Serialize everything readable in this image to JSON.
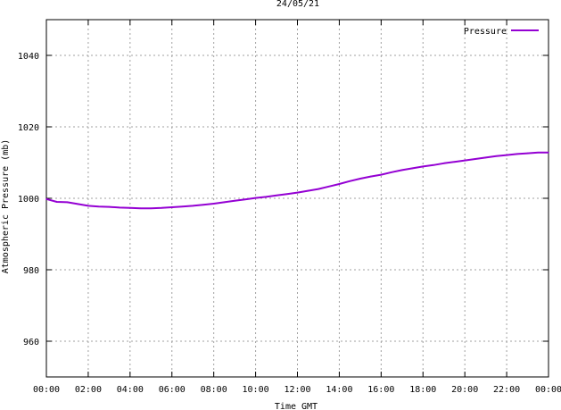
{
  "chart_data": {
    "type": "line",
    "title": "24/05/21",
    "xlabel": "Time GMT",
    "ylabel": "Atmospheric Pressure (mb)",
    "xlim": [
      0,
      24
    ],
    "ylim": [
      950,
      1050
    ],
    "x_ticks": [
      "00:00",
      "02:00",
      "04:00",
      "06:00",
      "08:00",
      "10:00",
      "12:00",
      "14:00",
      "16:00",
      "18:00",
      "20:00",
      "22:00",
      "00:00"
    ],
    "y_ticks": [
      960,
      980,
      1000,
      1020,
      1040
    ],
    "grid": true,
    "legend_position": "top-right",
    "series": [
      {
        "name": "Pressure",
        "color": "#9400d3",
        "x": [
          0,
          0.5,
          1,
          1.5,
          2,
          2.5,
          3,
          3.5,
          4,
          4.5,
          5,
          5.5,
          6,
          6.5,
          7,
          7.5,
          8,
          8.5,
          9,
          9.5,
          10,
          10.5,
          11,
          11.5,
          12,
          12.5,
          13,
          13.5,
          14,
          14.5,
          15,
          15.5,
          16,
          16.5,
          17,
          17.5,
          18,
          18.5,
          19,
          19.5,
          20,
          20.5,
          21,
          21.5,
          22,
          22.5,
          23,
          23.5,
          24
        ],
        "values": [
          999.8,
          999.0,
          998.9,
          998.4,
          997.9,
          997.7,
          997.6,
          997.4,
          997.3,
          997.2,
          997.2,
          997.3,
          997.5,
          997.7,
          997.9,
          998.2,
          998.5,
          998.9,
          999.3,
          999.7,
          1000.1,
          1000.4,
          1000.8,
          1001.2,
          1001.6,
          1002.1,
          1002.6,
          1003.3,
          1004.0,
          1004.8,
          1005.5,
          1006.1,
          1006.6,
          1007.3,
          1007.9,
          1008.4,
          1008.9,
          1009.3,
          1009.8,
          1010.2,
          1010.6,
          1011.0,
          1011.4,
          1011.8,
          1012.1,
          1012.4,
          1012.6,
          1012.8,
          1012.8
        ]
      }
    ]
  }
}
